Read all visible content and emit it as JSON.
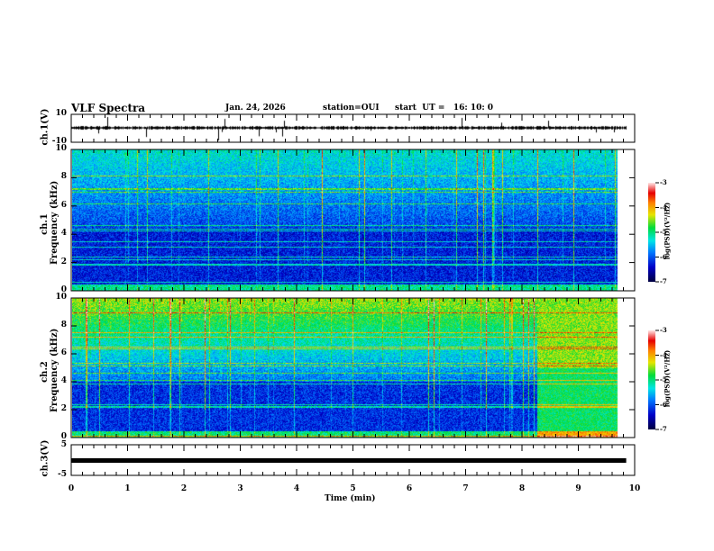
{
  "header": {
    "title": "VLF Spectra",
    "date": "Jan. 24, 2026",
    "station": "station=OUI",
    "start": "start  UT =   16: 10: 0"
  },
  "chart_data": [
    {
      "type": "line",
      "panel": "ch1-waveform",
      "ylabel": "ch.1(V)",
      "ylim": [
        -10,
        10
      ],
      "yticks": [
        "10",
        "-10"
      ],
      "xlim": [
        0,
        10
      ],
      "data_end": 9.85
    },
    {
      "type": "heatmap",
      "panel": "ch1-spectrogram",
      "ylabel": "ch.1\nFrequency (kHz)",
      "ylabel1": "ch.1",
      "ylabel2": "Frequency (kHz)",
      "ylim": [
        0,
        10
      ],
      "yticks": [
        "0",
        "2",
        "4",
        "6",
        "8",
        "10"
      ],
      "xlim": [
        0,
        10
      ],
      "colorbar": {
        "label": "log(PSD)(V²/Hz)",
        "range": [
          -7,
          -3
        ],
        "ticks": [
          "-3",
          "-4",
          "-5",
          "-6",
          "-7"
        ]
      }
    },
    {
      "type": "heatmap",
      "panel": "ch2-spectrogram",
      "ylabel1": "ch.2",
      "ylabel2": "Frequency (kHz)",
      "ylim": [
        0,
        10
      ],
      "yticks": [
        "0",
        "2",
        "4",
        "6",
        "8",
        "10"
      ],
      "xlim": [
        0,
        10
      ],
      "note": "broadband change after ~8.4 min",
      "colorbar": {
        "label": "log(PSD)(V²/Hz)",
        "range": [
          -7,
          -3
        ],
        "ticks": [
          "-3",
          "-4",
          "-5",
          "-6",
          "-7"
        ]
      }
    },
    {
      "type": "line",
      "panel": "ch3-waveform",
      "ylabel": "ch.3(V)",
      "ylim": [
        -5,
        5
      ],
      "yticks": [
        "5",
        "-5"
      ],
      "constant_value": -1,
      "xlim": [
        0,
        10
      ]
    }
  ],
  "xaxis": {
    "label": "Time (min)",
    "ticks": [
      "0",
      "1",
      "2",
      "3",
      "4",
      "5",
      "6",
      "7",
      "8",
      "9",
      "10"
    ]
  }
}
